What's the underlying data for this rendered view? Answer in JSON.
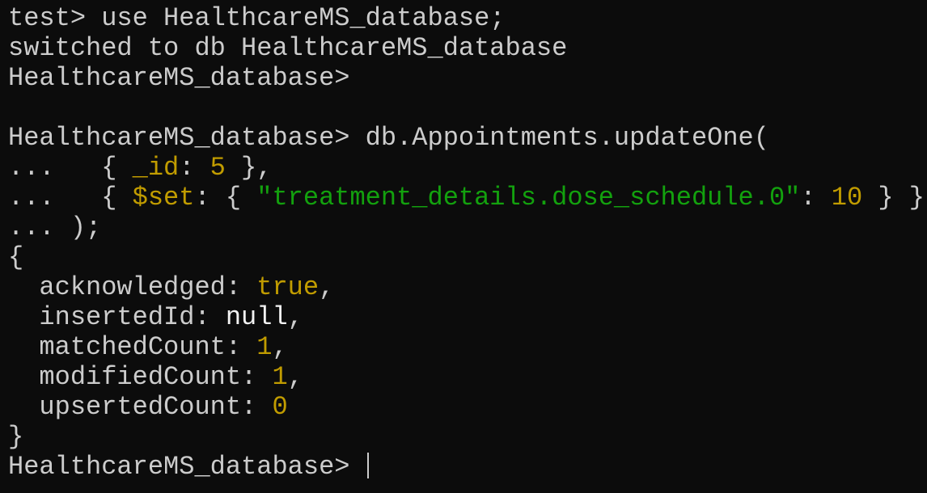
{
  "colors": {
    "background": "#0c0c0c",
    "default": "#cccccc",
    "yellow": "#c19c00",
    "green": "#13a10e",
    "white": "#f2f2f2"
  },
  "terminal": {
    "lines": [
      [
        {
          "t": "test> use HealthcareMS_database;",
          "c": "default"
        }
      ],
      [
        {
          "t": "switched to db HealthcareMS_database",
          "c": "default"
        }
      ],
      [
        {
          "t": "HealthcareMS_database>",
          "c": "default"
        }
      ],
      [],
      [
        {
          "t": "HealthcareMS_database> db.Appointments.updateOne(",
          "c": "default"
        }
      ],
      [
        {
          "t": "...   { ",
          "c": "default"
        },
        {
          "t": "_id",
          "c": "yellow"
        },
        {
          "t": ": ",
          "c": "default"
        },
        {
          "t": "5",
          "c": "yellow"
        },
        {
          "t": " },",
          "c": "default"
        }
      ],
      [
        {
          "t": "...   { ",
          "c": "default"
        },
        {
          "t": "$set",
          "c": "yellow"
        },
        {
          "t": ": { ",
          "c": "default"
        },
        {
          "t": "\"treatment_details.dose_schedule.0\"",
          "c": "green"
        },
        {
          "t": ": ",
          "c": "default"
        },
        {
          "t": "10",
          "c": "yellow"
        },
        {
          "t": " } }",
          "c": "default"
        }
      ],
      [
        {
          "t": "... );",
          "c": "default"
        }
      ],
      [
        {
          "t": "{",
          "c": "default"
        }
      ],
      [
        {
          "t": "  acknowledged: ",
          "c": "default"
        },
        {
          "t": "true",
          "c": "yellow"
        },
        {
          "t": ",",
          "c": "default"
        }
      ],
      [
        {
          "t": "  insertedId: ",
          "c": "default"
        },
        {
          "t": "null",
          "c": "white"
        },
        {
          "t": ",",
          "c": "default"
        }
      ],
      [
        {
          "t": "  matchedCount: ",
          "c": "default"
        },
        {
          "t": "1",
          "c": "yellow"
        },
        {
          "t": ",",
          "c": "default"
        }
      ],
      [
        {
          "t": "  modifiedCount: ",
          "c": "default"
        },
        {
          "t": "1",
          "c": "yellow"
        },
        {
          "t": ",",
          "c": "default"
        }
      ],
      [
        {
          "t": "  upsertedCount: ",
          "c": "default"
        },
        {
          "t": "0",
          "c": "yellow"
        }
      ],
      [
        {
          "t": "}",
          "c": "default"
        }
      ],
      [
        {
          "t": "HealthcareMS_database> ",
          "c": "default"
        }
      ]
    ]
  }
}
